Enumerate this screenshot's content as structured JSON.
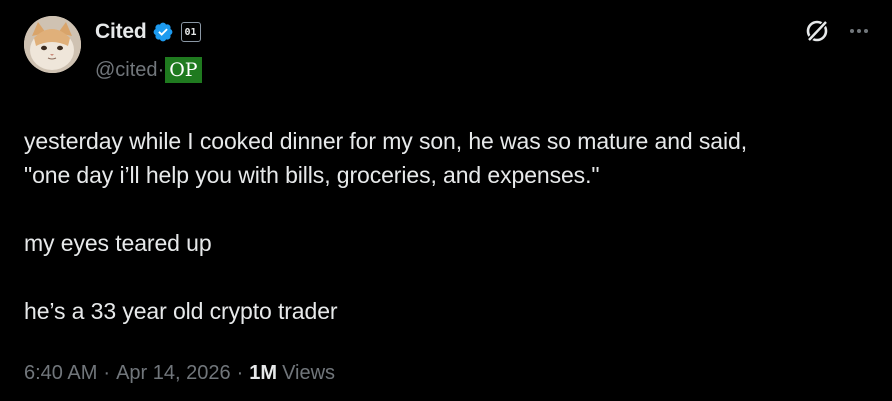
{
  "author": {
    "display_name": "Cited",
    "handle": "@cited",
    "affiliation_badge": "01",
    "op_badge": "OP",
    "verified": true,
    "avatar_icon": "cat-avatar"
  },
  "actions": {
    "grok_icon": "grok-icon",
    "more_icon": "more-options-icon"
  },
  "post": {
    "lines": [
      "yesterday while I cooked dinner for my son, he was so mature and said,",
      "\"one day i’ll help you with bills, groceries, and expenses.\"",
      "my eyes teared up",
      "he’s a 33 year old crypto trader"
    ]
  },
  "meta": {
    "time": "6:40 AM",
    "dot1": "·",
    "date": "Apr 14, 2026",
    "dot2": "·",
    "views_count": "1M",
    "views_label": "Views"
  },
  "colors": {
    "background": "#000000",
    "text": "#e7e9ea",
    "secondary": "#71767b",
    "verified_blue": "#1d9bf0",
    "op_green": "#1f7a1f"
  }
}
